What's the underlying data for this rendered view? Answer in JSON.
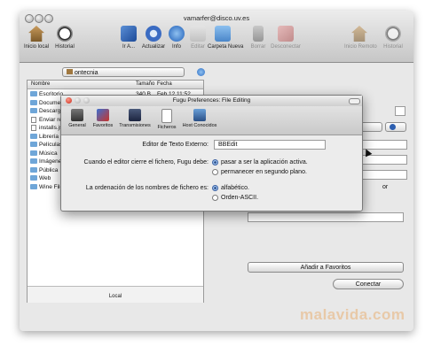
{
  "window": {
    "title": "vamarfer@disco.uv.es"
  },
  "toolbar": {
    "items": [
      {
        "label": "Inicio local",
        "icon": "home-icon",
        "dim": false
      },
      {
        "label": "Historial",
        "icon": "clock-icon",
        "dim": false
      },
      {
        "label": "Ir A...",
        "icon": "go-to-icon",
        "dim": false
      },
      {
        "label": "Actualizar",
        "icon": "refresh-icon",
        "dim": false
      },
      {
        "label": "Info",
        "icon": "info-icon",
        "dim": false
      },
      {
        "label": "Editar",
        "icon": "edit-icon",
        "dim": true
      },
      {
        "label": "Carpeta Nueva",
        "icon": "new-folder-icon",
        "dim": false
      },
      {
        "label": "Borrar",
        "icon": "trash-icon",
        "dim": true
      },
      {
        "label": "Desconectar",
        "icon": "disconnect-icon",
        "dim": true
      },
      {
        "label": "Inicio Remoto",
        "icon": "home-icon",
        "dim": true
      },
      {
        "label": "Historial",
        "icon": "clock-icon",
        "dim": true
      }
    ]
  },
  "local": {
    "path": "ontecnia",
    "columns": [
      "Nombre",
      "Tamaño",
      "Fecha"
    ],
    "rows": [
      {
        "name": "Escritorio",
        "size": "340 B",
        "date": "Feb 12 11:52",
        "type": "folder"
      },
      {
        "name": "Documentos",
        "size": "238 B",
        "date": "Feb 12 09:42",
        "type": "folder"
      },
      {
        "name": "Descarga",
        "size": "",
        "date": "",
        "type": "folder"
      },
      {
        "name": "Enviar re",
        "size": "",
        "date": "",
        "type": "file"
      },
      {
        "name": "installs.js",
        "size": "",
        "date": "",
        "type": "file"
      },
      {
        "name": "Librería",
        "size": "",
        "date": "",
        "type": "folder"
      },
      {
        "name": "Películas",
        "size": "",
        "date": "",
        "type": "folder"
      },
      {
        "name": "Música",
        "size": "",
        "date": "",
        "type": "folder"
      },
      {
        "name": "Imágenes",
        "size": "",
        "date": "",
        "type": "folder"
      },
      {
        "name": "Pública",
        "size": "",
        "date": "",
        "type": "folder"
      },
      {
        "name": "Web",
        "size": "",
        "date": "",
        "type": "folder"
      },
      {
        "name": "Wine File",
        "size": "",
        "date": "",
        "type": "folder"
      }
    ],
    "footer": "Local"
  },
  "remote": {
    "partial_label": "or",
    "add_favorites": "Añadir a Favoritos",
    "connect": "Conectar"
  },
  "dialog": {
    "title": "Fugu Preferences: File Editing",
    "tabs": [
      "General",
      "Favoritos",
      "Transmisiones",
      "Ficheros",
      "Host Conocidos"
    ],
    "editor_label": "Editor de Texto Externo:",
    "editor_value": "BBEdit",
    "close_label": "Cuando el editor cierre el fichero, Fugu debe:",
    "close_opt1": "pasar a ser la aplicación activa.",
    "close_opt2": "permanecer en segundo plano.",
    "order_label": "La ordenación de los nombres de fichero es:",
    "order_opt1": "alfabético.",
    "order_opt2": "Orden-ASCII."
  },
  "watermark": "malavida.com",
  "colors": {
    "accent": "#3d62a3",
    "watermark": "#e8c9a8"
  }
}
